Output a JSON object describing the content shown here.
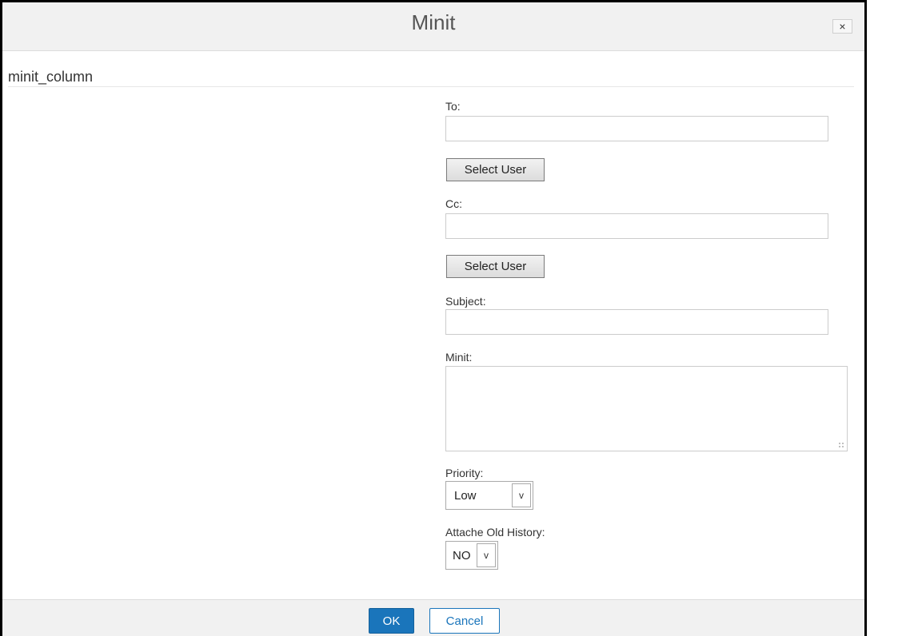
{
  "dialog": {
    "title": "Minit",
    "close_label": "×",
    "section_title": "minit_column"
  },
  "form": {
    "to_label": "To:",
    "to_value": "",
    "select_user_label": "Select User",
    "cc_label": "Cc:",
    "cc_value": "",
    "select_user_cc_label": "Select User",
    "subject_label": "Subject:",
    "subject_value": "",
    "minit_label": "Minit:",
    "minit_value": "",
    "priority_label": "Priority:",
    "priority_value": "Low",
    "history_label": "Attache Old History:",
    "history_value": "NO",
    "dropdown_arrow": "v"
  },
  "footer": {
    "ok_label": "OK",
    "cancel_label": "Cancel"
  },
  "colors": {
    "primary": "#1a75bb",
    "header_bg": "#f1f1f1"
  }
}
